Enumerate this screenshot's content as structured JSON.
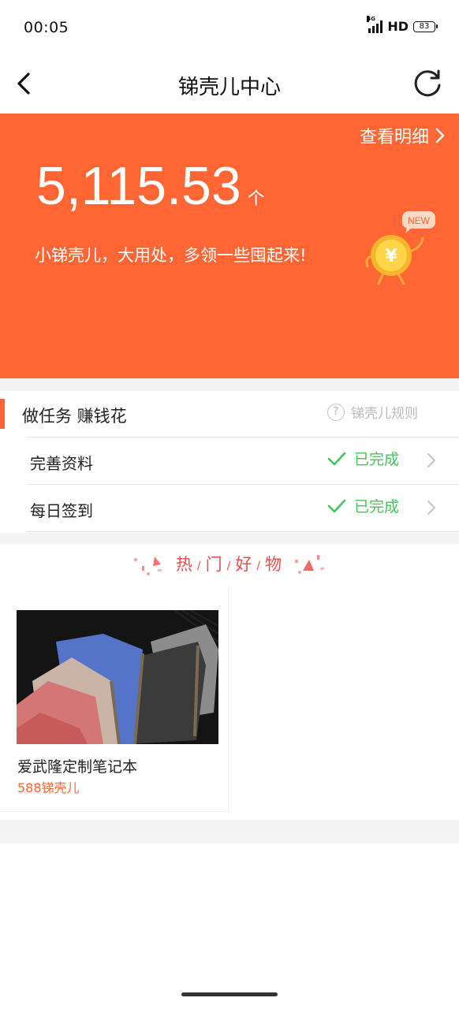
{
  "status_bar": {
    "time": "00:05",
    "network": "4G",
    "hd": "HD",
    "battery": "83"
  },
  "nav": {
    "title": "锑壳儿中心",
    "back_icon": "chevron-left-icon",
    "refresh_icon": "refresh-icon"
  },
  "hero": {
    "detail_label": "查看明细",
    "balance": "5,115.53",
    "unit": "个",
    "slogan": "小锑壳儿，大用处，多领一些囤起来!",
    "mascot_badge": "NEW",
    "mascot_symbol": "¥",
    "background_color": "#ff6633"
  },
  "tasks": {
    "title": "做任务 赚钱花",
    "rules_label": "锑壳儿规则",
    "items": [
      {
        "label": "完善资料",
        "status": "已完成"
      },
      {
        "label": "每日签到",
        "status": "已完成"
      }
    ],
    "status_color": "#43c45a"
  },
  "hot_goods": {
    "title_chars": [
      "热",
      "门",
      "好",
      "物"
    ],
    "products": [
      {
        "name": "爱武隆定制笔记本",
        "price": "588锑壳儿"
      }
    ]
  }
}
